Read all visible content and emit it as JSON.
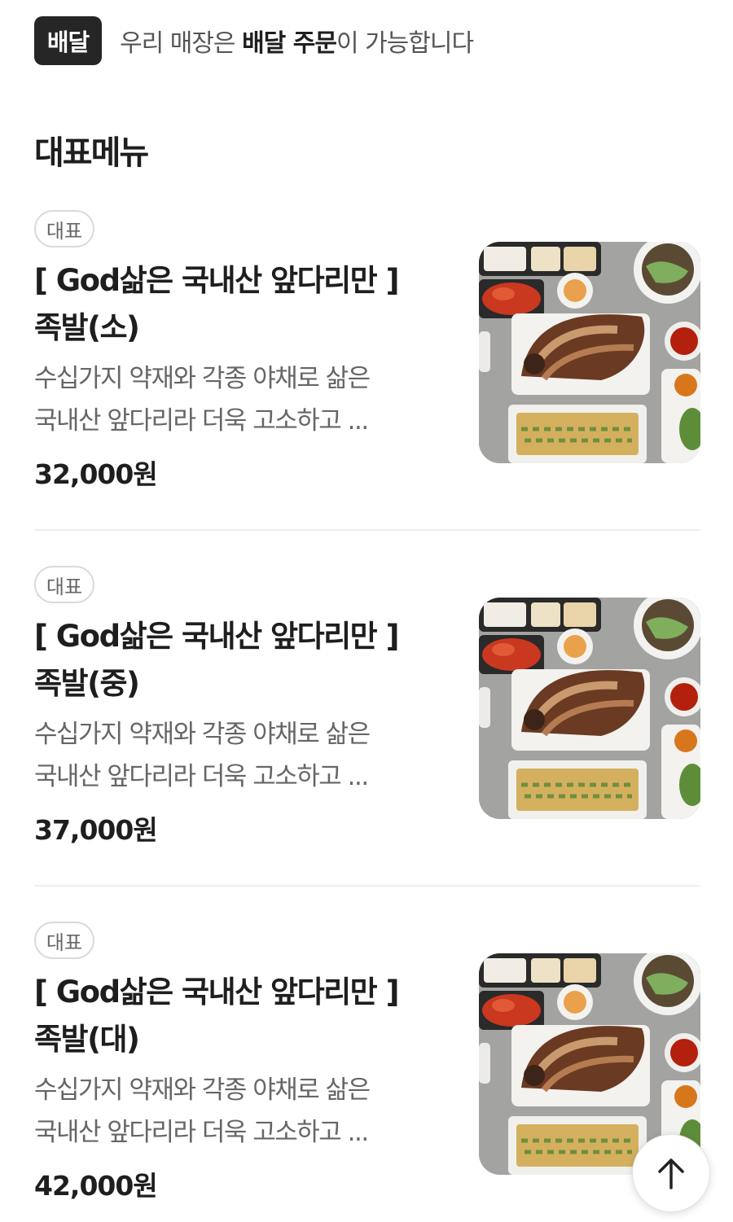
{
  "delivery": {
    "badge": "배달",
    "text_prefix": "우리 매장은 ",
    "text_bold": "배달 주문",
    "text_suffix": "이 가능합니다"
  },
  "section_title": "대표메뉴",
  "menu_items": [
    {
      "badge": "대표",
      "name_line1": "[ God삶은 국내산 앞다리만 ]",
      "name_line2": "족발(소)",
      "desc_line1": "수십가지 약재와 각종 야채로 삶은",
      "desc_line2": "국내산 앞다리라 더욱 고소하고 ...",
      "price": "32,000원"
    },
    {
      "badge": "대표",
      "name_line1": "[ God삶은 국내산 앞다리만 ]",
      "name_line2": "족발(중)",
      "desc_line1": "수십가지 약재와 각종 야채로 삶은",
      "desc_line2": "국내산 앞다리라 더욱 고소하고 ...",
      "price": "37,000원"
    },
    {
      "badge": "대표",
      "name_line1": "[ God삶은 국내산 앞다리만 ]",
      "name_line2": "족발(대)",
      "desc_line1": "수십가지 약재와 각종 야채로 삶은",
      "desc_line2": "국내산 앞다리라 더욱 고소하고 ...",
      "price": "42,000원"
    }
  ],
  "scroll_top_icon": "arrow-up-icon"
}
